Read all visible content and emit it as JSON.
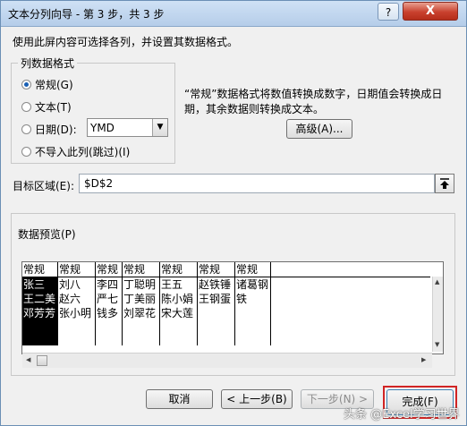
{
  "window": {
    "title": "文本分列向导 - 第 3 步，共 3 步",
    "help_label": "?",
    "close_label": "X"
  },
  "instruction": "使用此屏内容可选择各列，并设置其数据格式。",
  "column_format": {
    "group_label": "列数据格式",
    "options": [
      {
        "label": "常规(G)",
        "selected": true
      },
      {
        "label": "文本(T)",
        "selected": false
      },
      {
        "label": "日期(D):",
        "selected": false
      },
      {
        "label": "不导入此列(跳过)(I)",
        "selected": false
      }
    ],
    "date_format": "YMD",
    "description": "“常规”数据格式将数值转换成数字，日期值会转换成日期，其余数据则转换成文本。",
    "advanced_label": "高级(A)..."
  },
  "destination": {
    "label": "目标区域(E):",
    "value": "$D$2"
  },
  "preview": {
    "label": "数据预览(P)",
    "columns": [
      {
        "header": "常规",
        "lines": [
          "张三",
          "王二美",
          "邓芳芳"
        ],
        "selected": true
      },
      {
        "header": "常规",
        "lines": [
          "刘八",
          "赵六",
          "张小明"
        ],
        "selected": false
      },
      {
        "header": "常规",
        "lines": [
          "李四",
          "严七",
          "钱多"
        ],
        "selected": false
      },
      {
        "header": "常规",
        "lines": [
          "丁聪明",
          "丁美丽",
          "刘翠花"
        ],
        "selected": false
      },
      {
        "header": "常规",
        "lines": [
          "王五",
          "陈小娟",
          "宋大莲"
        ],
        "selected": false
      },
      {
        "header": "常规",
        "lines": [
          "赵铁锤",
          "王钢蛋",
          ""
        ],
        "selected": false
      },
      {
        "header": "常规",
        "lines": [
          "诸葛钢铁",
          "",
          ""
        ],
        "selected": false
      }
    ]
  },
  "buttons": {
    "cancel": "取消",
    "back": "< 上一步(B)",
    "next": "下一步(N) >",
    "finish": "完成(F)"
  },
  "watermark": "头条 @Excel学习世界",
  "colors": {
    "selected_column": "#000000",
    "highlight": "#d12424",
    "titlebar": "#cfe1f5"
  }
}
